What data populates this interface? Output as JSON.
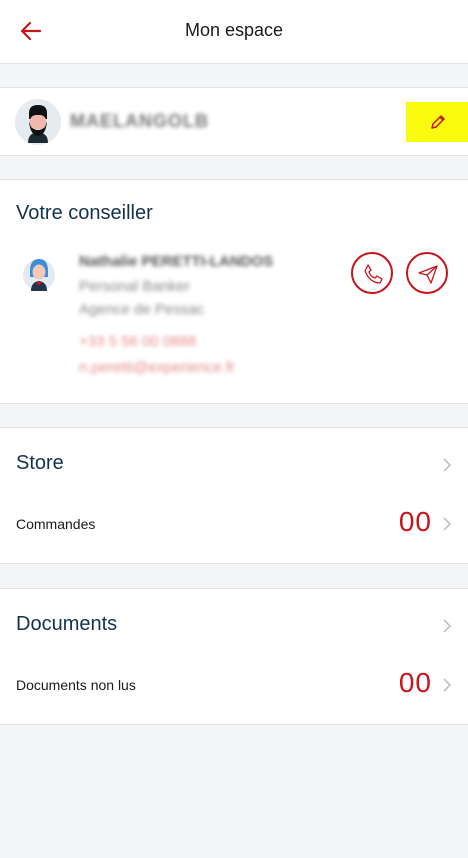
{
  "header": {
    "title": "Mon espace"
  },
  "profile": {
    "name": "MAELANGOLB"
  },
  "advisor": {
    "section_title": "Votre conseiller",
    "name": "Nathalie PERETTI-LANDOS",
    "role": "Personal Banker",
    "agency": "Agence de Pessac",
    "phone": "+33 5 56 00 0888",
    "email": "n.peretti@experience.fr"
  },
  "store": {
    "title": "Store",
    "sub_label": "Commandes",
    "count": "00"
  },
  "documents": {
    "title": "Documents",
    "sub_label": "Documents non lus",
    "count": "00"
  },
  "colors": {
    "accent": "#c8141b",
    "title": "#14324f",
    "highlight": "#fbfb10"
  },
  "icons": {
    "back": "arrow-left-icon",
    "edit": "pencil-icon",
    "call": "phone-icon",
    "send": "paper-plane-icon",
    "chevron": "chevron-right-icon"
  }
}
